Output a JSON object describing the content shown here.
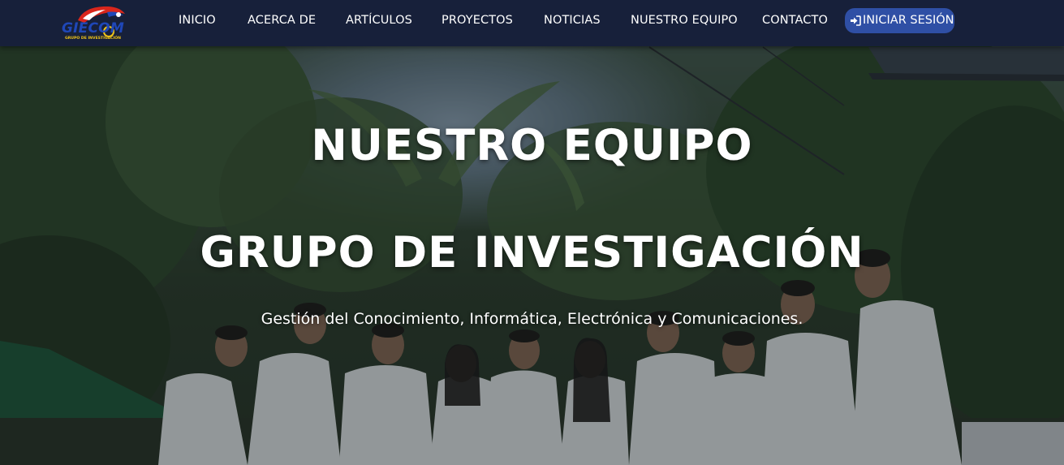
{
  "brand": {
    "logo_text": "GIECOM",
    "logo_subtext": "GRUPO DE INVESTIGACIÓN"
  },
  "nav": {
    "items": [
      {
        "label": "INICIO"
      },
      {
        "label": "ACERCA DE"
      },
      {
        "label": "ARTÍCULOS"
      },
      {
        "label": "PROYECTOS"
      },
      {
        "label": "NOTICIAS"
      },
      {
        "label": "NUESTRO EQUIPO"
      },
      {
        "label": "CONTACTO"
      }
    ],
    "login_label": "INICIAR SESIÓN",
    "login_icon": "sign-in-icon"
  },
  "hero": {
    "title": "NUESTRO EQUIPO",
    "subtitle": "GRUPO DE INVESTIGACIÓN",
    "tagline": "Gestión del Conocimiento, Informática, Electrónica y Comunicaciones."
  },
  "colors": {
    "navbar_bg": "#17203a",
    "login_button_bg": "#2f4fa5",
    "logo_blue": "#1f47b8",
    "logo_red": "#d9261c",
    "logo_yellow": "#f0c419",
    "text_white": "#ffffff"
  }
}
